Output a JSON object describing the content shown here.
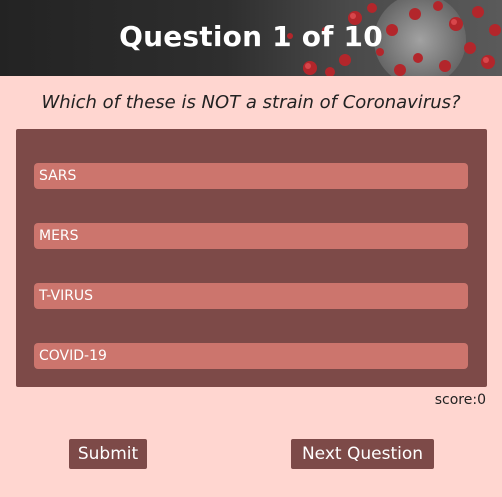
{
  "header": {
    "title": "Question 1 of 10"
  },
  "question": {
    "text": "Which of these is NOT a strain of Coronavirus?"
  },
  "answers": [
    {
      "label": "SARS"
    },
    {
      "label": "MERS"
    },
    {
      "label": "T-VIRUS"
    },
    {
      "label": "COVID-19"
    }
  ],
  "score": {
    "text": "score:0"
  },
  "buttons": {
    "submit_label": "Submit",
    "next_label": "Next Question"
  },
  "colors": {
    "page_background": "#ffd6d0",
    "panel": "#7d4a48",
    "answer_bar": "#cc756d",
    "header": "#2e2e2e"
  },
  "icons": {
    "header_art": "coronavirus-illustration"
  }
}
